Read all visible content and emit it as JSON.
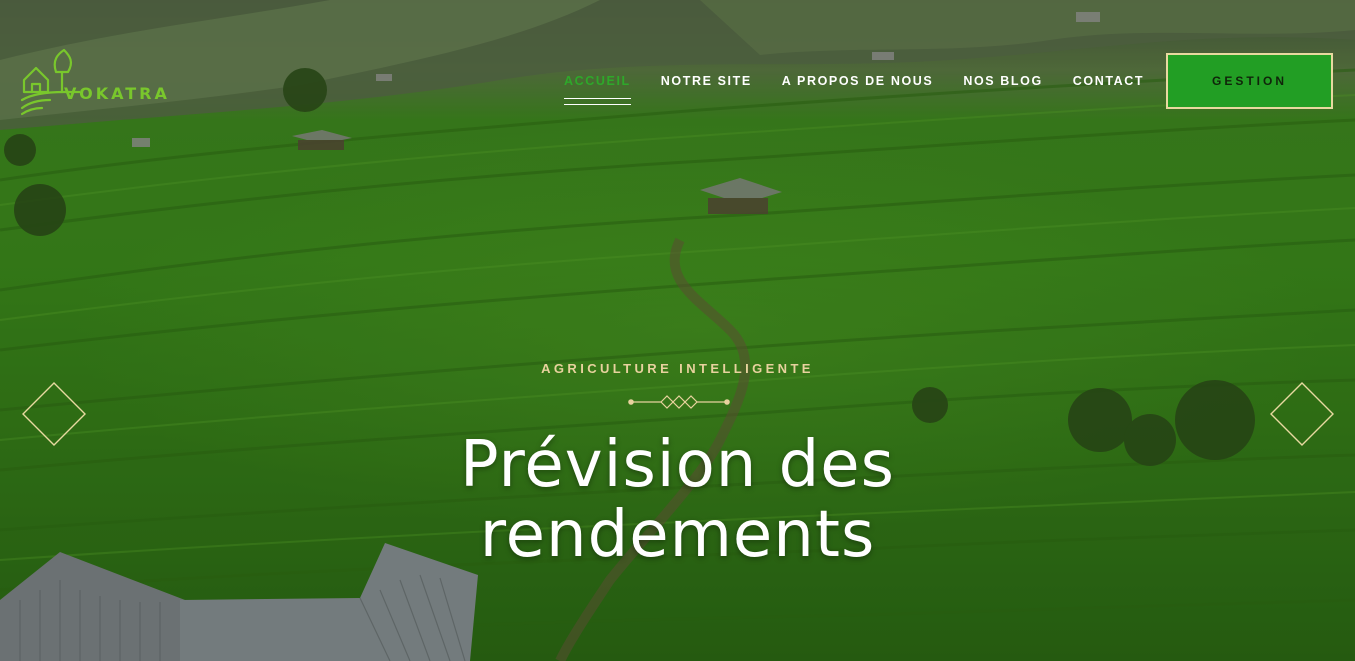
{
  "brand": {
    "name": "VOKATRA"
  },
  "nav": {
    "items": [
      {
        "label": "ACCUEIL",
        "active": true
      },
      {
        "label": "NOTRE SITE",
        "active": false
      },
      {
        "label": "A PROPOS DE NOUS",
        "active": false
      },
      {
        "label": "NOS BLOG",
        "active": false
      },
      {
        "label": "CONTACT",
        "active": false
      }
    ],
    "cta_label": "GESTION"
  },
  "hero": {
    "subtitle": "AGRICULTURE INTELLIGENTE",
    "title_line1": "Prévision des",
    "title_line2": "rendements"
  },
  "colors": {
    "accent_green": "#2ea82a",
    "cta_bg": "#229e24",
    "cta_border": "#e8d9a0",
    "subtitle": "#e8d29e"
  },
  "icons": {
    "logo": "farm-house-leaf-logo",
    "prev": "diamond-prev-icon",
    "next": "diamond-next-icon",
    "divider": "diamond-divider-icon"
  }
}
